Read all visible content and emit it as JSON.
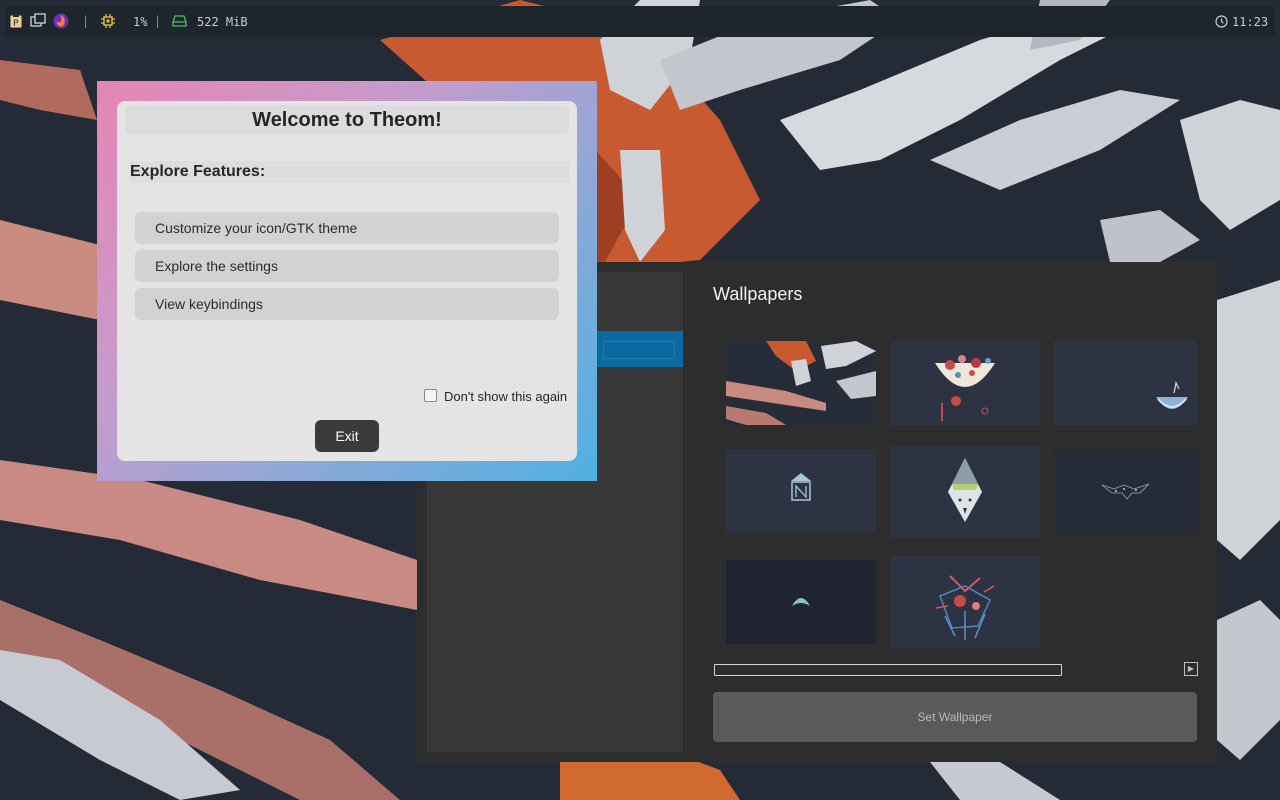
{
  "topbar": {
    "cpu_value": "1%",
    "separator": "|",
    "memory_value": "522 MiB",
    "clock": "11:23",
    "icons": [
      "clipboard-icon",
      "window-switcher-icon",
      "firefox-icon",
      "cpu-icon",
      "memory-icon",
      "clock-icon"
    ],
    "accent_colors": {
      "cpu": "#e3c13b",
      "memory": "#4fbf6a"
    }
  },
  "welcome": {
    "title": "Welcome to Theom!",
    "features_heading": "Explore Features:",
    "features": [
      {
        "label": "Customize your icon/GTK theme"
      },
      {
        "label": "Explore the settings"
      },
      {
        "label": "View keybindings"
      }
    ],
    "dont_show_label": "Don't show this again",
    "dont_show_checked": false,
    "exit_label": "Exit",
    "gradient_colors": [
      "#e585b4",
      "#8fa8d6",
      "#4fb1e2"
    ]
  },
  "settings": {
    "section_title": "Wallpapers",
    "set_wallpaper_label": "Set Wallpaper",
    "selected_color": "#0b6aa1",
    "thumbnails_count": 8
  }
}
